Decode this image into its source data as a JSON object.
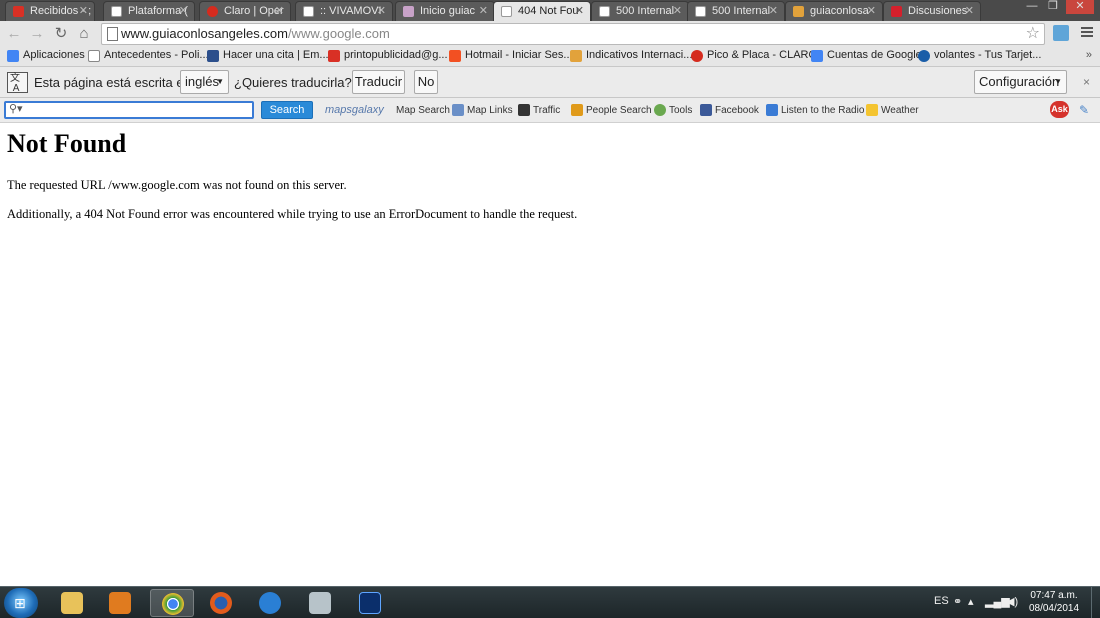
{
  "tabs": [
    {
      "label": "Recibidos - ;",
      "fav_color": "#d93025",
      "active": false
    },
    {
      "label": "Plataforma (",
      "fav_color": "#ffffff",
      "active": false
    },
    {
      "label": "Claro | Oper",
      "fav_color": "#d52b1e",
      "active": false
    },
    {
      "label": ":: VIVAMOVI",
      "fav_color": "#ffffff",
      "active": false
    },
    {
      "label": "Inicio guiac",
      "fav_color": "#c8a2c8",
      "active": false
    },
    {
      "label": "404 Not Fou",
      "fav_color": "#ffffff",
      "active": true
    },
    {
      "label": "500 Internal",
      "fav_color": "#ffffff",
      "active": false
    },
    {
      "label": "500 Internal",
      "fav_color": "#ffffff",
      "active": false
    },
    {
      "label": "guiaconlosa",
      "fav_color": "#e2a23b",
      "active": false
    },
    {
      "label": "Discusiones",
      "fav_color": "#d4202c",
      "active": false
    }
  ],
  "window_controls": {
    "minimize": "—",
    "maximize": "❐",
    "close": "✕"
  },
  "nav": {
    "back": "back-icon",
    "forward": "forward-icon",
    "reload": "reload-icon",
    "home": "home-icon"
  },
  "omnibox": {
    "host": "www.guiaconlosangeles.com",
    "path": "/www.google.com"
  },
  "bookmarks": [
    {
      "label": "Aplicaciones",
      "color": "#4285f4"
    },
    {
      "label": "Antecedentes - Poli...",
      "color": "#ffffff"
    },
    {
      "label": "Hacer una cita | Em...",
      "color": "#2c4f8c"
    },
    {
      "label": "printopublicidad@g...",
      "color": "#d93025"
    },
    {
      "label": "Hotmail - Iniciar Ses...",
      "color": "#f25022"
    },
    {
      "label": "Indicativos Internaci...",
      "color": "#e2a23b"
    },
    {
      "label": "Pico & Placa - CLARO",
      "color": "#d52b1e"
    },
    {
      "label": "Cuentas de Google",
      "color": "#4285f4"
    },
    {
      "label": "volantes - Tus Tarjet...",
      "color": "#1a5da8"
    }
  ],
  "bookmarks_more": "»",
  "translate": {
    "text_before": "Esta página está escrita en",
    "language": "inglés",
    "question": "¿Quieres traducirla?",
    "translate_btn": "Traducir",
    "no_btn": "No",
    "config_btn": "Configuración",
    "close": "×"
  },
  "ask_toolbar": {
    "search_btn": "Search",
    "logo": "mapsgalaxy",
    "items": [
      {
        "label": "Map Search",
        "color": "#ffffff"
      },
      {
        "label": "Map Links",
        "color": "#6a8fc7"
      },
      {
        "label": "Traffic",
        "color": "#333333"
      },
      {
        "label": "People Search",
        "color": "#e09a1a"
      },
      {
        "label": "Tools",
        "color": "#6aa84f"
      },
      {
        "label": "Facebook",
        "color": "#3b5998"
      },
      {
        "label": "Listen to the Radio",
        "color": "#3a7bd5"
      },
      {
        "label": "Weather",
        "color": "#f4c430"
      }
    ],
    "ask_logo": "Ask"
  },
  "page": {
    "title": "Not Found",
    "para1": "The requested URL /www.google.com was not found on this server.",
    "para2": "Additionally, a 404 Not Found error was encountered while trying to use an ErrorDocument to handle the request."
  },
  "taskbar": {
    "apps": [
      {
        "name": "explorer",
        "color": "#e8c25a",
        "active": false
      },
      {
        "name": "media-player",
        "color": "#e07b1f",
        "active": false
      },
      {
        "name": "chrome",
        "color": "#3a9a3a",
        "active": true
      },
      {
        "name": "firefox",
        "color": "#e25b1c",
        "active": false
      },
      {
        "name": "internet-explorer",
        "color": "#2a7fd4",
        "active": false
      },
      {
        "name": "scanner",
        "color": "#b7c3c9",
        "active": false
      },
      {
        "name": "photoshop",
        "color": "#0b2f6b",
        "active": false
      }
    ],
    "lang": "ES",
    "time": "07:47 a.m.",
    "date": "08/04/2014"
  }
}
